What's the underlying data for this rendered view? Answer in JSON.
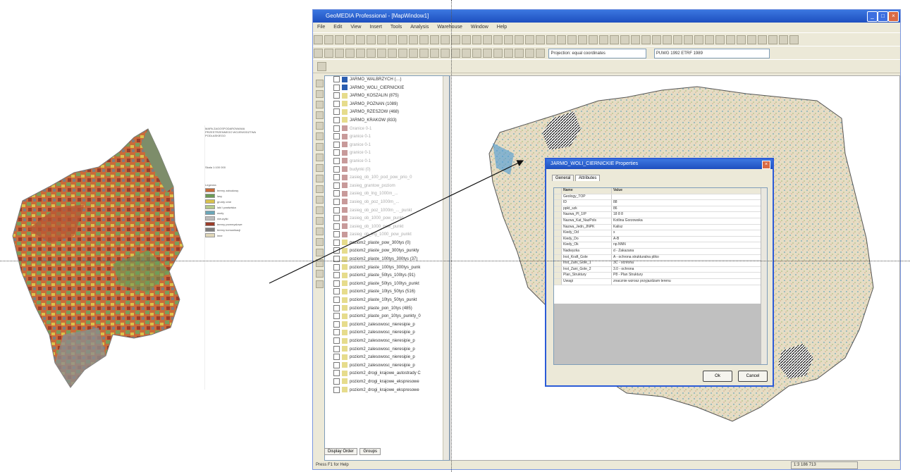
{
  "window": {
    "title": "GeoMEDIA Professional - [MapWindow1]",
    "minimize": "_",
    "maximize": "□",
    "close": "×"
  },
  "menu": [
    "File",
    "Edit",
    "View",
    "Insert",
    "Tools",
    "Analysis",
    "Warehouse",
    "Window",
    "Help"
  ],
  "toolbar": {
    "projection_select": "Projection: equal coordinates",
    "scale_select": "PUWG 1992 ETRF 1989"
  },
  "toc_layers": [
    {
      "label": "JARMO_WALBRZYCH (…)",
      "style": "active"
    },
    {
      "label": "JARMO_WOLI_CIERNICKIE",
      "style": "active"
    },
    {
      "label": "JARMO_KOSZALIN (875)",
      "style": "normal"
    },
    {
      "label": "JARMO_POZNAN (1089)",
      "style": "normal"
    },
    {
      "label": "JARMO_RZESZOW (468)",
      "style": "normal"
    },
    {
      "label": "JARMO_KRAKOW (833)",
      "style": "normal"
    },
    {
      "label": "Granice 0-1",
      "style": "dim"
    },
    {
      "label": "granice 0-1",
      "style": "dim"
    },
    {
      "label": "granice 0-1",
      "style": "dim"
    },
    {
      "label": "granice 0-1",
      "style": "dim"
    },
    {
      "label": "granice 0-1",
      "style": "dim"
    },
    {
      "label": "budynki (0)",
      "style": "dim"
    },
    {
      "label": "zasieg_ob_100_pod_pow_prio_0",
      "style": "dim"
    },
    {
      "label": "zasieg_grantow_poziom",
      "style": "dim"
    },
    {
      "label": "zasieg_ob_lng_1000m_...",
      "style": "dim"
    },
    {
      "label": "zasieg_ob_poz_1000m_...",
      "style": "dim"
    },
    {
      "label": "zasieg_ob_poz_1000m_..._punkt",
      "style": "dim"
    },
    {
      "label": "zasieg_ob_1000_pow_punkt",
      "style": "dim"
    },
    {
      "label": "zasieg_ob_1000_pow_punkt",
      "style": "dim"
    },
    {
      "label": "zasieg_ob_lng_1000_pow_punkt",
      "style": "dim"
    },
    {
      "label": "poziom2_plaste_pow_300tys (0)",
      "style": "normal"
    },
    {
      "label": "poziom2_plaste_pow_300tys_punkty",
      "style": "normal"
    },
    {
      "label": "poziom2_plaste_100tys_300tys (37)",
      "style": "normal"
    },
    {
      "label": "poziom2_plaste_100tys_300tys_punk",
      "style": "normal"
    },
    {
      "label": "poziom2_plaste_50tys_100tys (91)",
      "style": "normal"
    },
    {
      "label": "poziom2_plaste_50tys_100tys_punkt",
      "style": "normal"
    },
    {
      "label": "poziom2_plaste_10tys_50tys (516)",
      "style": "normal"
    },
    {
      "label": "poziom2_plaste_10tys_50tys_punkt",
      "style": "normal"
    },
    {
      "label": "poziom2_plaste_pon_10tys (485)",
      "style": "normal"
    },
    {
      "label": "poziom2_plaste_pon_10tys_punkty_0",
      "style": "normal"
    },
    {
      "label": "poziom2_zalesowosc_nieresipie_p",
      "style": "normal"
    },
    {
      "label": "poziom2_zalesowosc_nieresipie_p",
      "style": "normal"
    },
    {
      "label": "poziom2_zalesowosc_nieresipie_p",
      "style": "normal"
    },
    {
      "label": "poziom2_zalesowosc_nieresipie_p",
      "style": "normal"
    },
    {
      "label": "poziom2_zalesowosc_nieresipie_p",
      "style": "normal"
    },
    {
      "label": "poziom2_zalesowosc_nieresipie_p",
      "style": "normal"
    },
    {
      "label": "poziom2_drogi_krajowe_autostrady C",
      "style": "normal"
    },
    {
      "label": "poziom2_drogi_krajowe_ekspresowe",
      "style": "normal"
    },
    {
      "label": "poziom2_drogi_krajowe_ekspresowe",
      "style": "normal"
    }
  ],
  "toc_tabs": [
    "Display Order",
    "Groups"
  ],
  "status": {
    "text": "Press F1 for Help",
    "scale": "1:3 186 713"
  },
  "dialog": {
    "title": "JARMO_WOLI_CIERNICKIE Properties",
    "tabs": [
      "General",
      "Attributes"
    ],
    "columns": [
      "Name",
      "Value"
    ],
    "rows": [
      {
        "name": "Geology_TOP",
        "value": ""
      },
      {
        "name": "ID",
        "value": "88"
      },
      {
        "name": "ppkt_szk",
        "value": "86"
      },
      {
        "name": "Nazwa_Pl_1IP",
        "value": "18 8 8"
      },
      {
        "name": "Nazwa_Kat_NazPols",
        "value": "Kotlina Gorzowska"
      },
      {
        "name": "Nazwa_Jedn_JNPK",
        "value": "Kalisz"
      },
      {
        "name": "Kiedy_Od",
        "value": "x"
      },
      {
        "name": "Kiedy_Do",
        "value": "A-B"
      },
      {
        "name": "Kiedy_Ok",
        "value": "np.NNN"
      },
      {
        "name": "Nadwyzka",
        "value": "d - Zakazana"
      },
      {
        "name": "Inst_Kraft_Gole",
        "value": "A - ochrona strukturalna pliko"
      },
      {
        "name": "Inst_Zani_Gole_1",
        "value": "3C - ochrona"
      },
      {
        "name": "Inst_Zani_Gole_2",
        "value": "3.0 - ochrona"
      },
      {
        "name": "Plan_Struktury",
        "value": "P8 - Plan Struktury"
      },
      {
        "name": "Uwagi",
        "value": "znacznie wzrosz przyjazdzam terenu"
      }
    ],
    "ok": "Ok",
    "cancel": "Cancel"
  },
  "legend_sheet": {
    "title_lines": [
      "MAPA ZAGOSPODAROWANIA",
      "PRZESTRZENNEGO WOJEWODZTWA",
      "PODLASKIEGO"
    ],
    "scale_line": "Skala 1:100 000",
    "legend_heading": "Legenda",
    "legend_items": [
      "tereny zabudowy",
      "lasy",
      "grunty orne",
      "laki i pastwiska",
      "wody",
      "nieuzytki",
      "tereny przemyslowe",
      "tereny komunikacji",
      "inne"
    ]
  },
  "colors": {
    "title_blue": "#2352c8",
    "dialog_border": "#2b5bd7",
    "panel_bg": "#ece9d8",
    "map_highlight": "#111111"
  }
}
